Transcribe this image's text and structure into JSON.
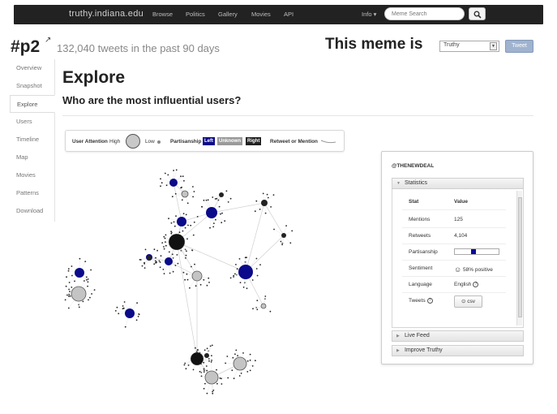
{
  "nav": {
    "brand": "truthy.indiana.edu",
    "links": [
      "Browse",
      "Politics",
      "Gallery",
      "Movies",
      "API"
    ],
    "info": "Info ▾",
    "search_placeholder": "Meme Search"
  },
  "header": {
    "meme": "#p2",
    "refresh_glyph": "↗",
    "tweet_count": "132,040 tweets in the past 90 days",
    "verdict_label": "This meme is",
    "verdict_value": "Truthy",
    "vote_button": "Tweet"
  },
  "sidebar": {
    "items": [
      {
        "label": "Overview"
      },
      {
        "label": "Snapshot"
      },
      {
        "label": "Explore"
      },
      {
        "label": "Users"
      },
      {
        "label": "Timeline"
      },
      {
        "label": "Map"
      },
      {
        "label": "Movies"
      },
      {
        "label": "Patterns"
      },
      {
        "label": "Download"
      }
    ],
    "active": "Explore"
  },
  "main": {
    "title": "Explore",
    "subtitle": "Who are the most influential users?"
  },
  "legend": {
    "attention_label": "User Attention",
    "attention_high": "High",
    "attention_low": "Low",
    "partisanship_label": "Partisanship",
    "left": "Left",
    "unknown": "Unknown",
    "right": "Right",
    "edge_label": "Retweet or Mention",
    "colors": {
      "left": "#0a0a8a",
      "unknown": "#9a9a9a",
      "right": "#222222"
    }
  },
  "user_panel": {
    "handle": "@THENEWDEAL",
    "statistics_tab": "Statistics",
    "table_header": {
      "stat": "Stat",
      "value": "Value"
    },
    "rows": [
      {
        "stat": "Mentions",
        "value": "125"
      },
      {
        "stat": "Retweets",
        "value": "4,104"
      },
      {
        "stat": "Partisanship",
        "value": ""
      },
      {
        "stat": "Sentiment",
        "value": "58% positive"
      },
      {
        "stat": "Language",
        "value": "English"
      },
      {
        "stat": "Tweets",
        "value": ""
      }
    ],
    "partisanship_level": 0.4,
    "csv_button": "csv",
    "live_feed_tab": "Live Feed",
    "improve_tab": "Improve Truthy"
  }
}
